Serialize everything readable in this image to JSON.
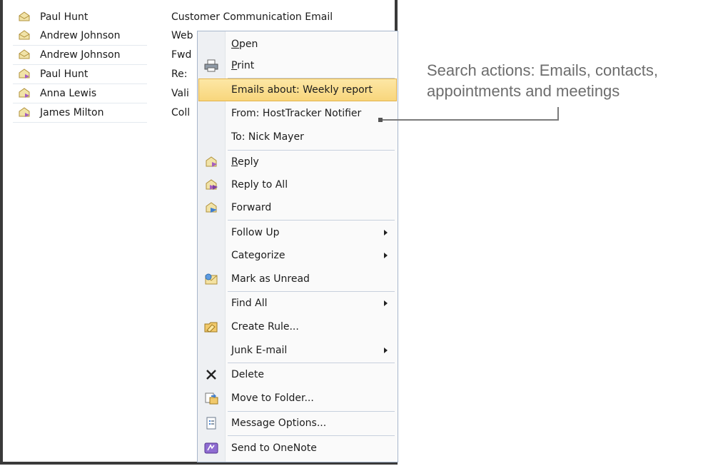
{
  "mail_list": [
    {
      "sender": "Paul Hunt",
      "subject": "Customer Communication Email",
      "icon": "envelope-open-icon"
    },
    {
      "sender": "Andrew Johnson",
      "subject": "Web",
      "icon": "envelope-open-icon"
    },
    {
      "sender": "Andrew Johnson",
      "subject": "Fwd",
      "icon": "envelope-open-icon"
    },
    {
      "sender": "Paul Hunt",
      "subject": "Re:",
      "icon": "envelope-replied-icon"
    },
    {
      "sender": "Anna Lewis",
      "subject": "Vali",
      "icon": "envelope-replied-icon"
    },
    {
      "sender": "James Milton",
      "subject": "Coll",
      "icon": "envelope-replied-icon"
    }
  ],
  "context_menu": {
    "items": [
      {
        "label": "Open",
        "ul": "O",
        "icon": null
      },
      {
        "label": "Print",
        "ul": "P",
        "icon": "printer-icon"
      },
      {
        "label": "Emails about: Weekly report",
        "highlighted": true
      },
      {
        "label": "From: HostTracker Notifier"
      },
      {
        "label": "To: Nick Mayer"
      },
      {
        "label": "Reply",
        "ul": "R",
        "icon": "reply-icon"
      },
      {
        "label": "Reply to All",
        "icon": "reply-all-icon"
      },
      {
        "label": "Forward",
        "icon": "forward-icon"
      },
      {
        "label": "Follow Up",
        "submenu": true
      },
      {
        "label": "Categorize",
        "submenu": true
      },
      {
        "label": "Mark as Unread",
        "icon": "mark-unread-icon"
      },
      {
        "label": "Find All",
        "submenu": true
      },
      {
        "label": "Create Rule...",
        "icon": "create-rule-icon"
      },
      {
        "label": "Junk E-mail",
        "submenu": true
      },
      {
        "label": "Delete",
        "icon": "delete-icon"
      },
      {
        "label": "Move to Folder...",
        "icon": "move-folder-icon"
      },
      {
        "label": "Message Options...",
        "icon": "message-options-icon"
      },
      {
        "label": "Send to OneNote",
        "icon": "onenote-icon"
      }
    ]
  },
  "callout": {
    "text": "Search actions: Emails, contacts, appointments and meetings"
  },
  "colors": {
    "highlight_top": "#fde7a5",
    "highlight_bottom": "#f8d67c",
    "frame": "#3a3a3a",
    "callout_text": "#6d6d6d"
  }
}
